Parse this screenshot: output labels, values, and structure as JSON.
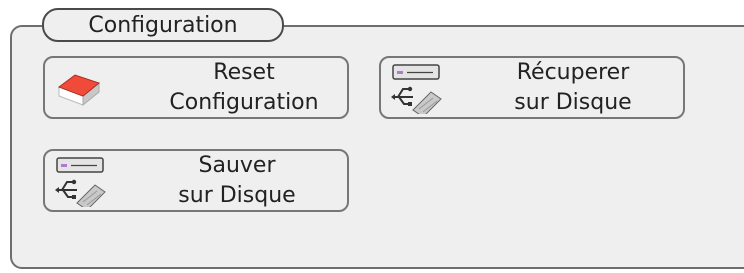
{
  "group": {
    "title": "Configuration"
  },
  "buttons": {
    "reset": {
      "line1": "Reset",
      "line2": "Configuration",
      "icon": "eraser-icon"
    },
    "recuperer": {
      "line1": "Récuperer",
      "line2": "sur Disque",
      "icon": "usb-drive-icon"
    },
    "sauver": {
      "line1": "Sauver",
      "line2": "sur Disque",
      "icon": "usb-drive-icon"
    }
  },
  "colors": {
    "panel_bg": "#efefef",
    "eraser_red": "#e33b2a",
    "usb_accent": "#b07ad0"
  }
}
